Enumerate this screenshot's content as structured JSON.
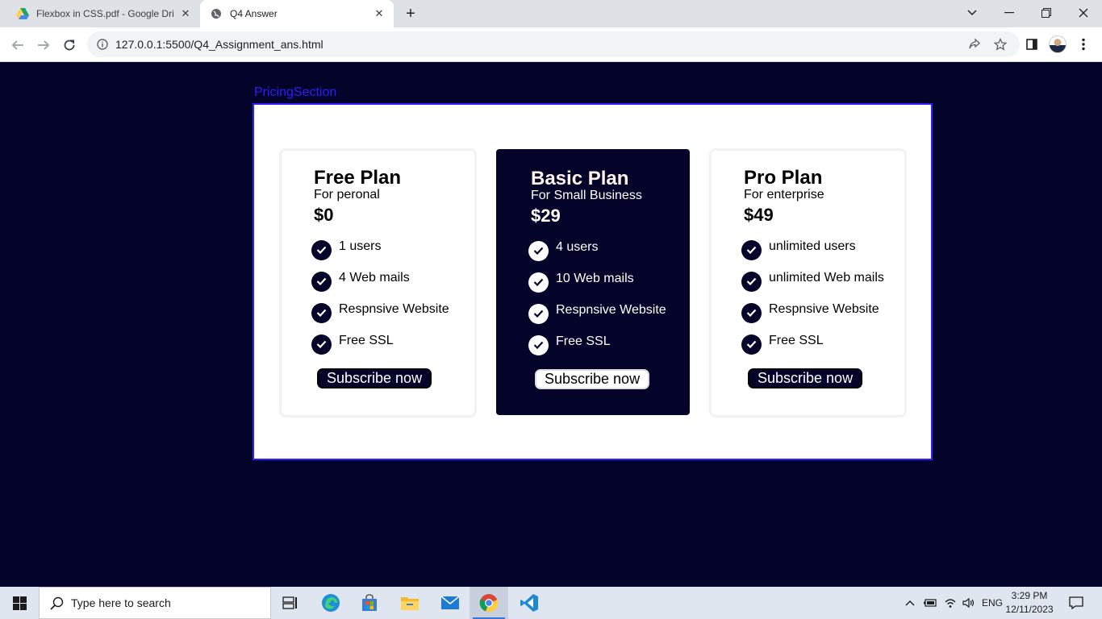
{
  "browser": {
    "tabs": [
      {
        "title": "Flexbox in CSS.pdf - Google Drive",
        "favicon": "google-drive-icon",
        "active": false
      },
      {
        "title": "Q4 Answer",
        "favicon": "globe-icon",
        "active": true
      }
    ],
    "url": "127.0.0.1:5500/Q4_Assignment_ans.html"
  },
  "page": {
    "section_label": "PricingSection",
    "plans": [
      {
        "name": "Free Plan",
        "subtitle": "For peronal",
        "price": "$0",
        "features": [
          "1 users",
          "4 Web mails",
          "Respnsive Website",
          "Free SSL"
        ],
        "button": "Subscribe now",
        "featured": false
      },
      {
        "name": "Basic Plan",
        "subtitle": "For Small Business",
        "price": "$29",
        "features": [
          "4 users",
          "10 Web mails",
          "Respnsive Website",
          "Free SSL"
        ],
        "button": "Subscribe now",
        "featured": true
      },
      {
        "name": "Pro Plan",
        "subtitle": "For enterprise",
        "price": "$49",
        "features": [
          "unlimited users",
          "unlimited Web mails",
          "Respnsive Website",
          "Free SSL"
        ],
        "button": "Subscribe now",
        "featured": false
      }
    ],
    "colors": {
      "page_background": "#04032a",
      "section_border": "#2f1dff",
      "card_dark": "#04032a"
    }
  },
  "taskbar": {
    "search_placeholder": "Type here to search",
    "apps": [
      "task-view-icon",
      "edge-icon",
      "store-icon",
      "file-explorer-icon",
      "mail-icon",
      "chrome-icon",
      "vscode-icon"
    ],
    "language": "ENG",
    "time": "3:29 PM",
    "date": "12/11/2023"
  }
}
